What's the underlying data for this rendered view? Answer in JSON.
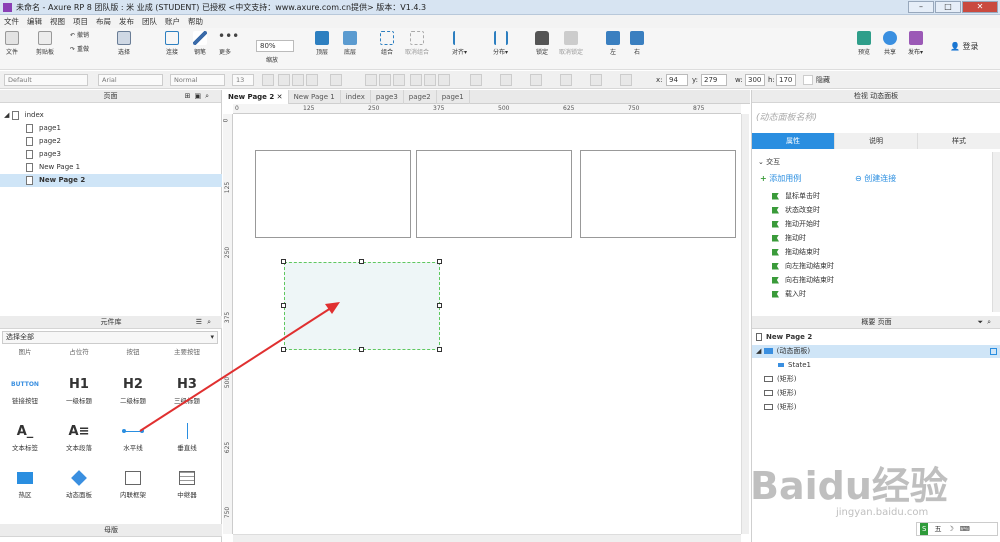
{
  "window": {
    "title": "未命名 - Axure RP 8 团队版 : 米 业成 (STUDENT) 已授权    <中文支持：www.axure.com.cn提供> 版本：V1.4.3"
  },
  "menu": [
    "文件",
    "编辑",
    "视图",
    "项目",
    "布局",
    "发布",
    "团队",
    "账户",
    "帮助"
  ],
  "toolbar": {
    "file": "文件",
    "clipboard": "剪贴板",
    "undo": "撤销",
    "redo": "重做",
    "select": "选择",
    "connect": "连接",
    "pen": "钢笔",
    "more": "更多",
    "zoom_value": "80%",
    "zoom_label": "缩放",
    "top": "顶层",
    "bottom": "底层",
    "group": "组合",
    "ungroup": "取消组合",
    "align": "对齐",
    "distribute": "分布",
    "lock": "锁定",
    "unlock": "取消锁定",
    "left": "左",
    "right": "右",
    "preview": "预览",
    "share": "共享",
    "publish": "发布",
    "login": "登录"
  },
  "format": {
    "style": "Default",
    "font": "Arial",
    "weight": "Normal",
    "size": "13",
    "x_label": "x:",
    "x": "94",
    "y_label": "y:",
    "y": "279",
    "w_label": "w:",
    "w": "300",
    "h_label": "h:",
    "h": "170",
    "hidden": "隐藏"
  },
  "pages_panel": {
    "title": "页面",
    "root": "index",
    "items": [
      "page1",
      "page2",
      "page3",
      "New Page 1",
      "New Page 2"
    ],
    "selected": "New Page 2"
  },
  "library": {
    "title": "元件库",
    "selector": "选择全部",
    "row0": [
      "图片",
      "占位符",
      "按钮",
      "主要按钮"
    ],
    "widgets": [
      {
        "icon": "BUTTON",
        "label": "链接按钮"
      },
      {
        "icon": "H1",
        "label": "一级标题"
      },
      {
        "icon": "H2",
        "label": "二级标题"
      },
      {
        "icon": "H3",
        "label": "三级标题"
      },
      {
        "icon": "A_",
        "label": "文本标签"
      },
      {
        "icon": "A≡",
        "label": "文本段落"
      },
      {
        "icon": "",
        "label": "水平线"
      },
      {
        "icon": "",
        "label": "垂直线"
      },
      {
        "icon": "",
        "label": "热区"
      },
      {
        "icon": "",
        "label": "动态面板"
      },
      {
        "icon": "",
        "label": "内联框架"
      },
      {
        "icon": "",
        "label": "中继器"
      }
    ]
  },
  "masters_panel": {
    "title": "母版"
  },
  "tabs": [
    "New Page 2",
    "New Page 1",
    "index",
    "page3",
    "page2",
    "page1"
  ],
  "ruler_h": [
    "0",
    "125",
    "250",
    "375",
    "500",
    "625",
    "750",
    "875"
  ],
  "ruler_v": [
    "0",
    "125",
    "250",
    "375",
    "500",
    "625",
    "750"
  ],
  "inspector": {
    "header": "检视  动态面板",
    "name_placeholder": "(动态面板名称)",
    "tabs": [
      "属性",
      "说明",
      "样式"
    ],
    "section": "交互",
    "add_case": "添加用例",
    "create_link": "创建连接",
    "events": [
      "鼠标单击时",
      "状态改变时",
      "拖动开始时",
      "拖动时",
      "拖动结束时",
      "向左拖动结束时",
      "向右拖动结束时",
      "载入时"
    ]
  },
  "outline": {
    "header": "概要  页面",
    "page": "New Page 2",
    "items": [
      {
        "label": "(动态面板)",
        "level": 0,
        "selected": true
      },
      {
        "label": "State1",
        "level": 1,
        "selected": false
      },
      {
        "label": "(矩形)",
        "level": 0,
        "selected": false
      },
      {
        "label": "(矩形)",
        "level": 0,
        "selected": false
      },
      {
        "label": "(矩形)",
        "level": 0,
        "selected": false
      }
    ]
  },
  "watermark": {
    "text": "Baidu经验",
    "sub": "jingyan.baidu.com"
  },
  "colors": {
    "accent": "#2a8ee0",
    "selection": "#cfe5f7",
    "panel_border": "#5fc85f",
    "arrow": "#e03030",
    "event_flag": "#3a9b3a"
  }
}
